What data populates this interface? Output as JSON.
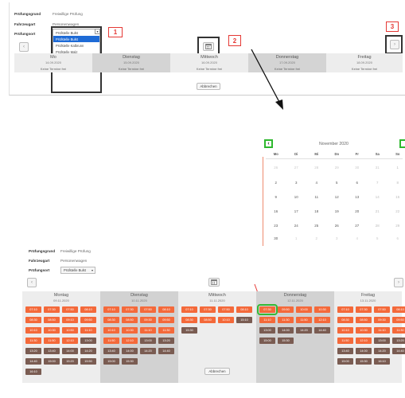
{
  "form": {
    "pruefungsgrund_label": "Prüfungsgrund",
    "pruefungsgrund_value": "Freiwillige Prüfung",
    "fahrzeugart_label": "Fahrzeugart",
    "fahrzeugart_value": "Personenwagen",
    "pruefungsort_label": "Prüfungsort",
    "pruefungsort_value": "Prüfstelle Bulst"
  },
  "dropdown": {
    "selected": "Prüfstelle Bulst",
    "options": [
      "Prüfstelle Bulst",
      "Prüfstelle Bulst",
      "Prüfstelle Kalbrunn",
      "Prüfstelle Malz",
      "Prüfstelle Oberbüren"
    ]
  },
  "callouts": {
    "one": "1",
    "two": "2",
    "three": "3"
  },
  "nav": {
    "prev": "‹",
    "next": "›"
  },
  "top_week": {
    "none_text": "Keine Termine frei",
    "days": [
      {
        "name": "Mo",
        "date": "14.09.2020"
      },
      {
        "name": "Dienstag",
        "date": "15.09.2020"
      },
      {
        "name": "Mittwoch",
        "date": "16.09.2020"
      },
      {
        "name": "Donnerstag",
        "date": "17.09.2020"
      },
      {
        "name": "Freitag",
        "date": "18.09.2020"
      }
    ]
  },
  "cancel_label": "Abbrechen",
  "picker": {
    "title": "November 2020",
    "weekdays": [
      "Mo",
      "Di",
      "Mi",
      "Do",
      "Fr",
      "Sa",
      "So"
    ],
    "weeks": [
      [
        "26",
        "27",
        "28",
        "29",
        "30",
        "31",
        "1"
      ],
      [
        "2",
        "3",
        "4",
        "5",
        "6",
        "7",
        "8"
      ],
      [
        "9",
        "10",
        "11",
        "12",
        "13",
        "14",
        "15"
      ],
      [
        "16",
        "17",
        "18",
        "19",
        "20",
        "21",
        "22"
      ],
      [
        "23",
        "24",
        "25",
        "26",
        "27",
        "28",
        "29"
      ],
      [
        "30",
        "1",
        "2",
        "3",
        "4",
        "5",
        "6"
      ]
    ]
  },
  "bottom_week": {
    "days": [
      {
        "name": "Montag",
        "date": "09.11.2020",
        "slots": [
          [
            "07:10",
            "free"
          ],
          [
            "07:30",
            "free"
          ],
          [
            "07:50",
            "free"
          ],
          [
            "08:10",
            "free"
          ],
          [
            "08:30",
            "free"
          ],
          [
            "08:50",
            "free"
          ],
          [
            "09:10",
            "free"
          ],
          [
            "09:50",
            "free"
          ],
          [
            "10:10",
            "free"
          ],
          [
            "10:30",
            "free"
          ],
          [
            "10:50",
            "free"
          ],
          [
            "11:10",
            "free"
          ],
          [
            "11:30",
            "free"
          ],
          [
            "11:50",
            "free"
          ],
          [
            "12:10",
            "free"
          ],
          [
            "13:00",
            "busy"
          ],
          [
            "13:20",
            "busy"
          ],
          [
            "13:40",
            "busy"
          ],
          [
            "14:00",
            "busy"
          ],
          [
            "14:20",
            "busy"
          ],
          [
            "14:40",
            "busy"
          ],
          [
            "15:00",
            "busy"
          ],
          [
            "15:20",
            "busy"
          ],
          [
            "15:50",
            "busy"
          ],
          [
            "16:10",
            "busy"
          ]
        ]
      },
      {
        "name": "Dienstag",
        "date": "10.11.2020",
        "slots": [
          [
            "07:10",
            "free"
          ],
          [
            "07:30",
            "free"
          ],
          [
            "07:50",
            "free"
          ],
          [
            "08:10",
            "free"
          ],
          [
            "08:30",
            "free"
          ],
          [
            "08:50",
            "free"
          ],
          [
            "09:30",
            "free"
          ],
          [
            "09:50",
            "free"
          ],
          [
            "10:10",
            "free"
          ],
          [
            "10:30",
            "free"
          ],
          [
            "11:10",
            "free"
          ],
          [
            "11:30",
            "free"
          ],
          [
            "11:50",
            "free"
          ],
          [
            "12:10",
            "free"
          ],
          [
            "13:00",
            "busy"
          ],
          [
            "13:20",
            "busy"
          ],
          [
            "13:40",
            "busy"
          ],
          [
            "14:00",
            "busy"
          ],
          [
            "14:20",
            "busy"
          ],
          [
            "14:40",
            "busy"
          ],
          [
            "15:00",
            "busy"
          ],
          [
            "15:30",
            "busy"
          ]
        ]
      },
      {
        "name": "Mittwoch",
        "date": "11.11.2020",
        "slots": [
          [
            "07:10",
            "free"
          ],
          [
            "07:30",
            "free"
          ],
          [
            "07:50",
            "free"
          ],
          [
            "08:10",
            "free"
          ],
          [
            "08:30",
            "free"
          ],
          [
            "08:50",
            "free"
          ],
          [
            "10:10",
            "free"
          ],
          [
            "15:10",
            "busy"
          ],
          [
            "15:30",
            "busy"
          ]
        ]
      },
      {
        "name": "Donnerstag",
        "date": "12.11.2020",
        "slots": [
          [
            "07:30",
            "free"
          ],
          [
            "09:50",
            "free"
          ],
          [
            "10:00",
            "free"
          ],
          [
            "10:30",
            "free"
          ],
          [
            "11:10",
            "free"
          ],
          [
            "11:30",
            "free"
          ],
          [
            "11:50",
            "free"
          ],
          [
            "12:10",
            "free"
          ],
          [
            "13:00",
            "busy"
          ],
          [
            "14:00",
            "busy"
          ],
          [
            "14:20",
            "busy"
          ],
          [
            "14:40",
            "busy"
          ],
          [
            "15:00",
            "busy"
          ],
          [
            "15:30",
            "busy"
          ]
        ]
      },
      {
        "name": "Freitag",
        "date": "13.11.2020",
        "slots": [
          [
            "07:10",
            "free"
          ],
          [
            "07:30",
            "free"
          ],
          [
            "07:50",
            "free"
          ],
          [
            "08:10",
            "free"
          ],
          [
            "08:30",
            "free"
          ],
          [
            "08:50",
            "free"
          ],
          [
            "09:30",
            "free"
          ],
          [
            "09:50",
            "free"
          ],
          [
            "10:10",
            "free"
          ],
          [
            "10:30",
            "free"
          ],
          [
            "11:10",
            "free"
          ],
          [
            "11:30",
            "free"
          ],
          [
            "11:50",
            "free"
          ],
          [
            "12:10",
            "free"
          ],
          [
            "13:00",
            "busy"
          ],
          [
            "13:20",
            "busy"
          ],
          [
            "13:40",
            "busy"
          ],
          [
            "14:00",
            "busy"
          ],
          [
            "14:20",
            "busy"
          ],
          [
            "14:40",
            "busy"
          ],
          [
            "15:00",
            "busy"
          ],
          [
            "15:30",
            "busy"
          ],
          [
            "16:10",
            "busy"
          ]
        ]
      }
    ]
  },
  "colors": {
    "slot_free": "#f4693a",
    "slot_busy": "#7a5c52",
    "highlight_green": "#34b934",
    "callout_red": "#e53935",
    "dropdown_selected": "#1e6bd6"
  }
}
